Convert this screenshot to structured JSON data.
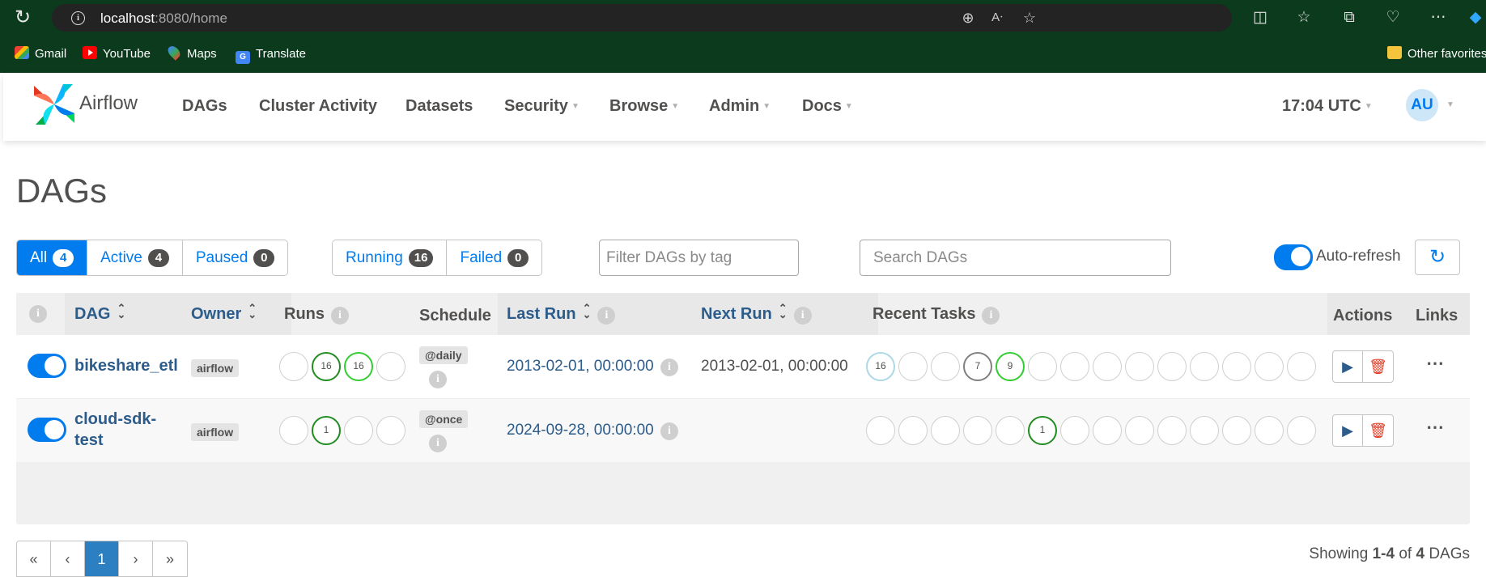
{
  "browser": {
    "url_host": "localhost",
    "url_rest": ":8080/home",
    "bookmarks": [
      "Gmail",
      "YouTube",
      "Maps",
      "Translate"
    ],
    "other_favorites": "Other favorites"
  },
  "navbar": {
    "brand": "Airflow",
    "items": [
      "DAGs",
      "Cluster Activity",
      "Datasets",
      "Security",
      "Browse",
      "Admin",
      "Docs"
    ],
    "clock": "17:04 UTC",
    "avatar": "AU"
  },
  "page": {
    "title": "DAGs"
  },
  "filters": {
    "status": [
      {
        "label": "All",
        "count": "4"
      },
      {
        "label": "Active",
        "count": "4"
      },
      {
        "label": "Paused",
        "count": "0"
      }
    ],
    "runs": [
      {
        "label": "Running",
        "count": "16"
      },
      {
        "label": "Failed",
        "count": "0"
      }
    ],
    "tag_placeholder": "Filter DAGs by tag",
    "search_placeholder": "Search DAGs",
    "auto_refresh_label": "Auto-refresh"
  },
  "table": {
    "headers": {
      "dag": "DAG",
      "owner": "Owner",
      "runs": "Runs",
      "schedule": "Schedule",
      "last_run": "Last Run",
      "next_run": "Next Run",
      "recent_tasks": "Recent Tasks",
      "actions": "Actions",
      "links": "Links"
    },
    "rows": [
      {
        "dag_id": "bikeshare_etl",
        "dag_id_line2": "",
        "owner": "airflow",
        "runs": [
          "",
          "16",
          "16",
          ""
        ],
        "schedule": "@daily",
        "last_run": "2013-02-01, 00:00:00",
        "next_run": "2013-02-01, 00:00:00",
        "recent_tasks": [
          "16",
          "",
          "",
          "7",
          "9",
          "",
          "",
          "",
          "",
          "",
          "",
          "",
          "",
          "",
          ""
        ]
      },
      {
        "dag_id": "cloud-sdk-",
        "dag_id_line2": "test",
        "owner": "airflow",
        "runs": [
          "",
          "1",
          "",
          ""
        ],
        "schedule": "@once",
        "last_run": "2024-09-28, 00:00:00",
        "next_run": "",
        "recent_tasks": [
          "",
          "",
          "",
          "",
          "",
          "1",
          "",
          "",
          "",
          "",
          "",
          "",
          "",
          "",
          ""
        ]
      }
    ]
  },
  "pagination": {
    "first": "«",
    "prev": "‹",
    "current": "1",
    "next": "›",
    "last": "»"
  },
  "footer": {
    "showing_prefix": "Showing ",
    "showing_range": "1-4",
    "showing_mid": " of ",
    "showing_total": "4",
    "showing_suffix": " DAGs"
  },
  "colors": {
    "accent": "#017cee",
    "browser_frame": "#0b3a1c",
    "success": "#228b22",
    "running": "#32cd32",
    "queued": "#808080",
    "upstream": "#add8e6",
    "delete": "#e43921"
  }
}
